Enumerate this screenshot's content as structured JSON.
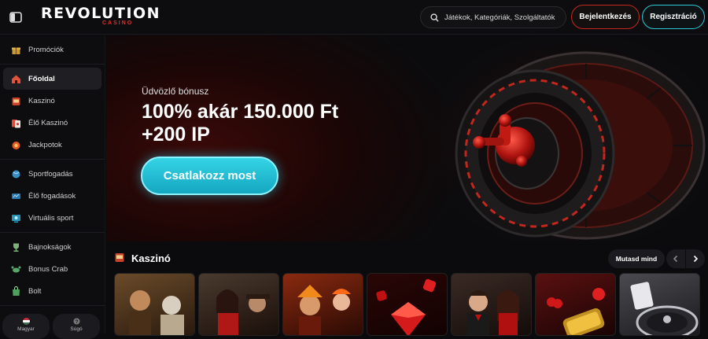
{
  "header": {
    "logo_text": "REVOLUTION",
    "logo_sub": "CASINO",
    "search_placeholder": "Játékok, Kategóriák, Szolgáltatók",
    "login_label": "Bejelentkezés",
    "register_label": "Regisztráció"
  },
  "sidebar": {
    "groups": [
      [
        {
          "label": "Promóciók",
          "icon": "gift-icon"
        }
      ],
      [
        {
          "label": "Főoldal",
          "icon": "home-icon",
          "active": true
        },
        {
          "label": "Kaszinó",
          "icon": "slot-machine-icon"
        },
        {
          "label": "Élő Kaszinó",
          "icon": "live-cards-icon"
        },
        {
          "label": "Jackpotok",
          "icon": "jackpot-icon"
        }
      ],
      [
        {
          "label": "Sportfogadás",
          "icon": "sports-ball-icon"
        },
        {
          "label": "Élő fogadások",
          "icon": "live-betting-icon"
        },
        {
          "label": "Virtuális sport",
          "icon": "virtual-sport-icon"
        }
      ],
      [
        {
          "label": "Bajnokságok",
          "icon": "trophy-icon"
        },
        {
          "label": "Bonus Crab",
          "icon": "crab-icon"
        },
        {
          "label": "Bolt",
          "icon": "shop-icon"
        }
      ]
    ],
    "language_label": "Magyar",
    "help_label": "Súgó"
  },
  "hero": {
    "subtitle": "Üdvözlő bónusz",
    "title_line1": "100% akár 150.000 Ft",
    "title_line2": "+200 IP",
    "cta_label": "Csatlakozz most"
  },
  "casino_section": {
    "title": "Kaszinó",
    "show_all_label": "Mutasd mind"
  },
  "colors": {
    "accent_red": "#c4281f",
    "accent_cyan": "#2cc7d6",
    "background": "#0b0b0d"
  }
}
